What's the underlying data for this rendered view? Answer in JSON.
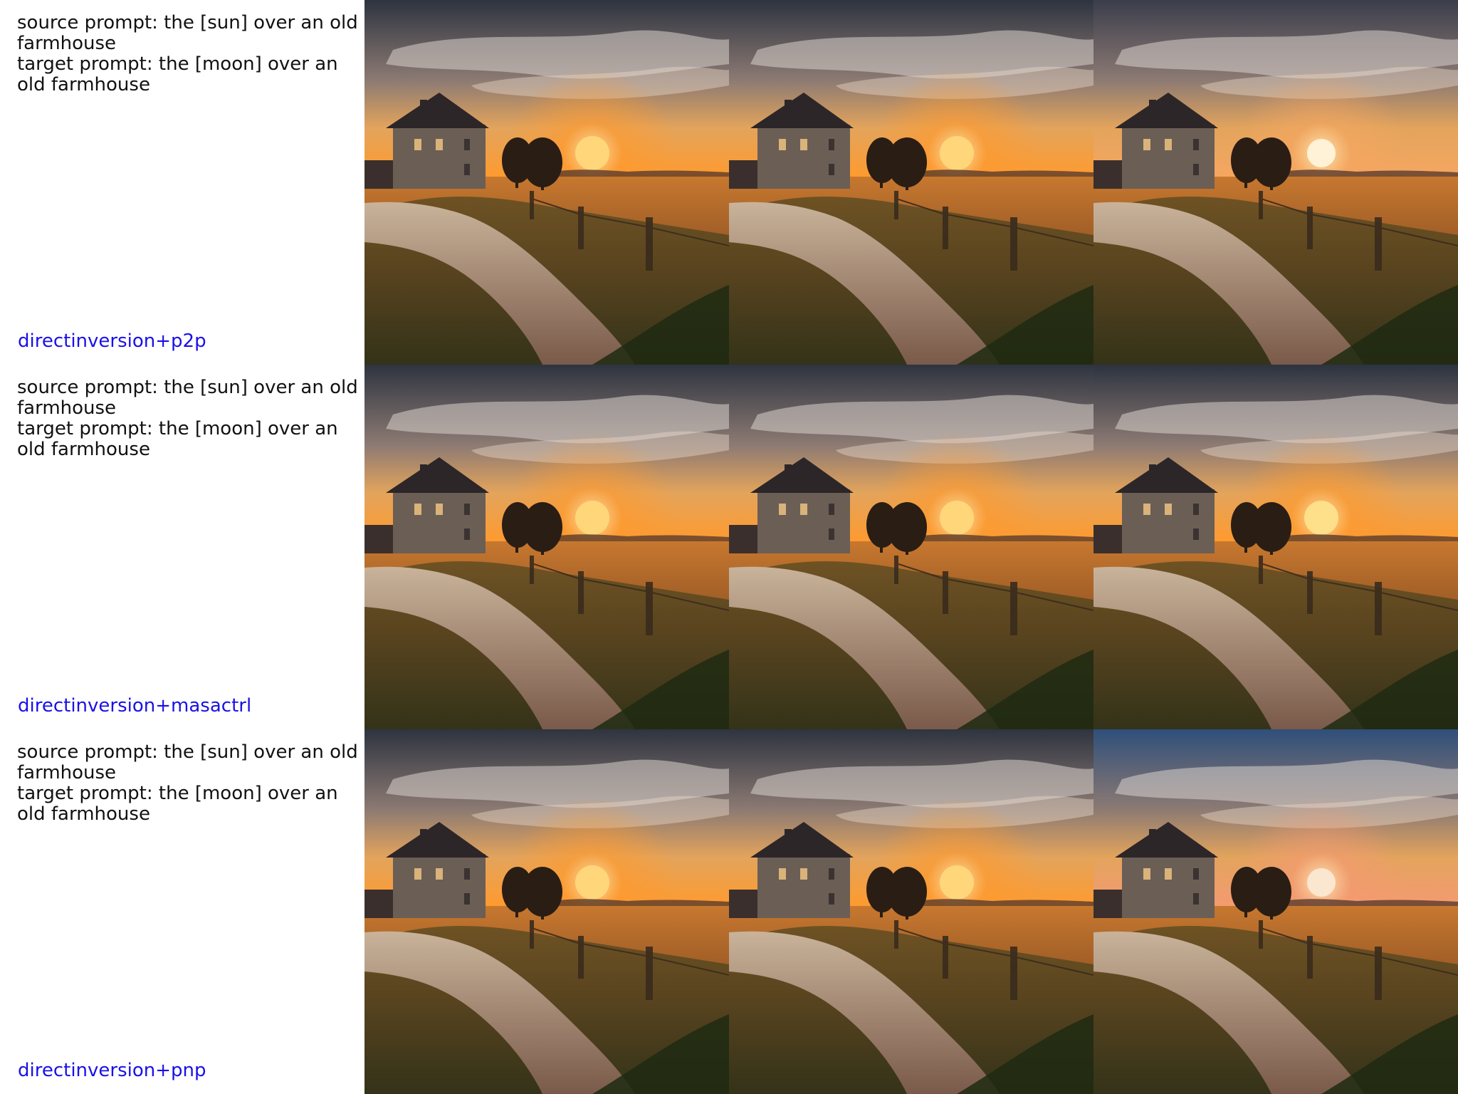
{
  "rows": [
    {
      "source_prompt": "source prompt: the [sun] over an old farmhouse",
      "target_prompt": "target prompt: the [moon] over an old farmhouse",
      "method": "directinversion+p2p",
      "method_color": "#1a10e8",
      "tiles": [
        {
          "orb": "sun",
          "orb_color": "#ffd77a",
          "sky_top": "#2e3440",
          "glow": "#ff9a2e"
        },
        {
          "orb": "sun",
          "orb_color": "#ffd77a",
          "sky_top": "#2e3440",
          "glow": "#ff9a2e"
        },
        {
          "orb": "moon",
          "orb_color": "#fff2d6",
          "sky_top": "#3b3d4c",
          "glow": "#f6a760"
        }
      ]
    },
    {
      "source_prompt": "source prompt: the [sun] over an old farmhouse",
      "target_prompt": "target prompt: the [moon] over an old farmhouse",
      "method": "directinversion+masactrl",
      "method_color": "#1a10e8",
      "tiles": [
        {
          "orb": "sun",
          "orb_color": "#ffd77a",
          "sky_top": "#2e3440",
          "glow": "#ff9a2e"
        },
        {
          "orb": "sun",
          "orb_color": "#ffd77a",
          "sky_top": "#2e3440",
          "glow": "#ff9a2e"
        },
        {
          "orb": "sun",
          "orb_color": "#ffe08a",
          "sky_top": "#2c3340",
          "glow": "#ff9a2e"
        }
      ]
    },
    {
      "source_prompt": "source prompt: the [sun] over an old farmhouse",
      "target_prompt": "target prompt: the [moon] over an old farmhouse",
      "method": "directinversion+pnp",
      "method_color": "#1a10e8",
      "tiles": [
        {
          "orb": "sun",
          "orb_color": "#ffd77a",
          "sky_top": "#2e3440",
          "glow": "#ff9a2e"
        },
        {
          "orb": "sun",
          "orb_color": "#ffd77a",
          "sky_top": "#2e3440",
          "glow": "#ff9a2e"
        },
        {
          "orb": "moon",
          "orb_color": "#fbe7d0",
          "sky_top": "#2f4f7a",
          "glow": "#f59a72"
        }
      ]
    }
  ]
}
